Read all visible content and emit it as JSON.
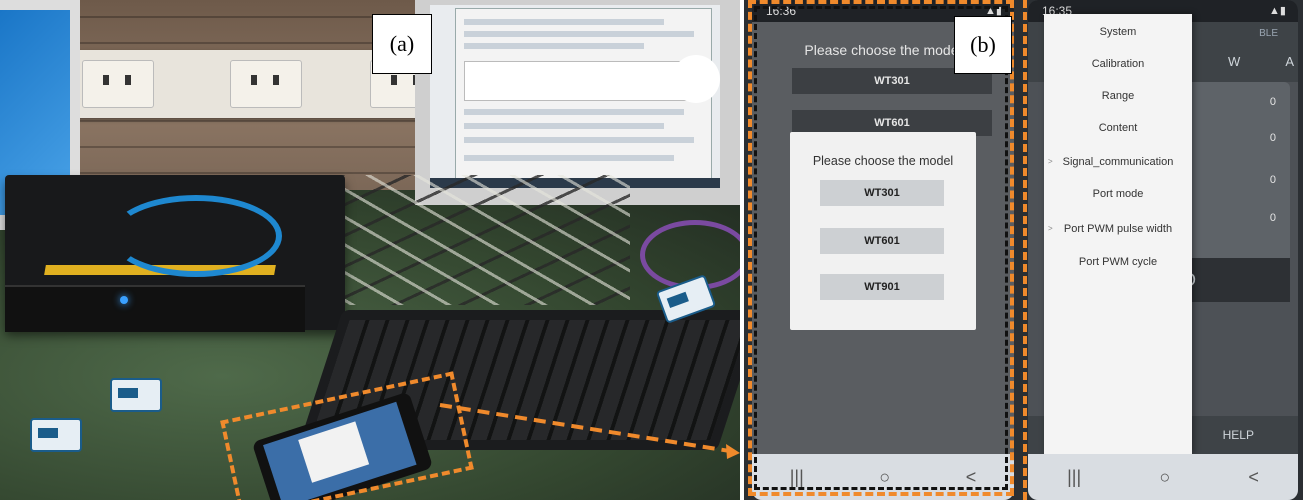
{
  "labels": {
    "panel_a": "(a)",
    "panel_b": "(b)"
  },
  "phone_left": {
    "status_time": "16:36",
    "background_title": "Please choose the model",
    "background_buttons": [
      "WT301",
      "WT601"
    ],
    "dialog_title": "Please choose the model",
    "dialog_buttons": [
      "WT301",
      "WT601",
      "WT901"
    ],
    "nav_icons": [
      "|||",
      "○",
      "<"
    ]
  },
  "phone_right": {
    "status_time": "16:35",
    "ble_label": "BLE",
    "w_label": "W",
    "a_label": "A",
    "values": [
      "0",
      "0",
      "0",
      "0"
    ],
    "record_fragment": "RD",
    "help_label": "HELP",
    "menu_items": [
      "System",
      "Calibration",
      "Range",
      "Content",
      "Signal_communication",
      "Port mode",
      "Port PWM pulse width",
      "Port PWM cycle"
    ],
    "nav_icons": [
      "|||",
      "○",
      "<"
    ]
  },
  "colors": {
    "highlight": "#f08a2c"
  }
}
